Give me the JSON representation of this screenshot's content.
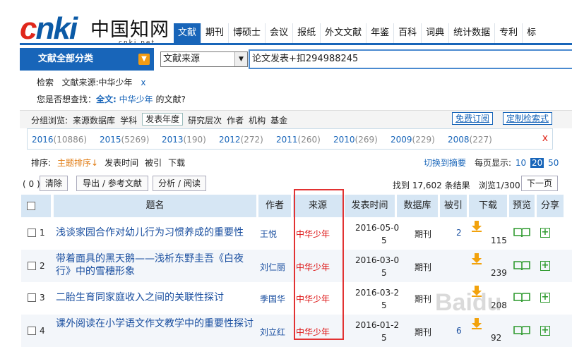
{
  "logo": {
    "cnki": "cnki",
    "cn": "中国知网",
    "url": "cnki.net"
  },
  "nav": [
    "文献",
    "期刊",
    "博硕士",
    "会议",
    "报纸",
    "外文文献",
    "年鉴",
    "百科",
    "词典",
    "统计数据",
    "专利",
    "标"
  ],
  "category": {
    "label": "文献全部分类"
  },
  "search": {
    "field": "文献来源",
    "query": "论文发表+扣294988245"
  },
  "crumb": {
    "a": "检索",
    "b": "文献来源:中华少年",
    "x": "x"
  },
  "suggest": {
    "pre": "您是否想查找：",
    "b": "全文:",
    "link": "中华少年",
    "post": " 的文献?"
  },
  "group": {
    "label": "分组浏览:",
    "items": [
      "来源数据库",
      "学科",
      "发表年度",
      "研究层次",
      "作者",
      "机构",
      "基金"
    ],
    "subscribe": "免费订阅",
    "custom": "定制检索式"
  },
  "years": [
    {
      "y": "2016",
      "n": "(10886)"
    },
    {
      "y": "2015",
      "n": "(5269)"
    },
    {
      "y": "2013",
      "n": "(190)"
    },
    {
      "y": "2012",
      "n": "(272)"
    },
    {
      "y": "2011",
      "n": "(260)"
    },
    {
      "y": "2010",
      "n": "(269)"
    },
    {
      "y": "2009",
      "n": "(229)"
    },
    {
      "y": "2008",
      "n": "(227)"
    }
  ],
  "years_close": "x",
  "sort": {
    "label": "排序:",
    "items": [
      "主题排序↓",
      "发表时间",
      "被引",
      "下载"
    ],
    "switch": "切换到摘要",
    "perpage_label": "每页显示:",
    "p10": "10",
    "p20": "20",
    "p50": "50"
  },
  "actions": {
    "count": "( 0 )",
    "clear": "清除",
    "export": "导出 / 参考文献",
    "analyze": "分析 / 阅读",
    "found": "找到 17,602 条结果",
    "browse": "浏览1/300",
    "next": "下一页"
  },
  "headers": {
    "title": "题名",
    "author": "作者",
    "source": "来源",
    "date": "发表时间",
    "db": "数据库",
    "cited": "被引",
    "dl": "下载",
    "preview": "预览",
    "share": "分享"
  },
  "rows": [
    {
      "n": "1",
      "title": "浅谈家园合作对幼儿行为习惯养成的重要性",
      "author": "王悦",
      "source": "中华少年",
      "date1": "2016-05-0",
      "date2": "5",
      "db": "期刊",
      "cited": "2",
      "dl": "115"
    },
    {
      "n": "2",
      "title": "带着面具的黑天鹅——浅析东野圭吾《白夜行》中的雪穗形象",
      "author": "刘仁丽",
      "source": "中华少年",
      "date1": "2016-03-0",
      "date2": "5",
      "db": "期刊",
      "cited": "",
      "dl": "239"
    },
    {
      "n": "3",
      "title": "二胎生育同家庭收入之间的关联性探讨",
      "author": "季国华",
      "source": "中华少年",
      "date1": "2016-03-2",
      "date2": "5",
      "db": "期刊",
      "cited": "",
      "dl": "208"
    },
    {
      "n": "4",
      "title": "课外阅读在小学语文作文教学中的重要性探讨",
      "author": "刘立红",
      "source": "中华少年",
      "date1": "2016-01-2",
      "date2": "5",
      "db": "期刊",
      "cited": "6",
      "dl": "92"
    }
  ],
  "watermark": "Baidu",
  "colors": {
    "brand": "#1865b9",
    "accent": "#f29b12",
    "highlight": "#e23232"
  }
}
